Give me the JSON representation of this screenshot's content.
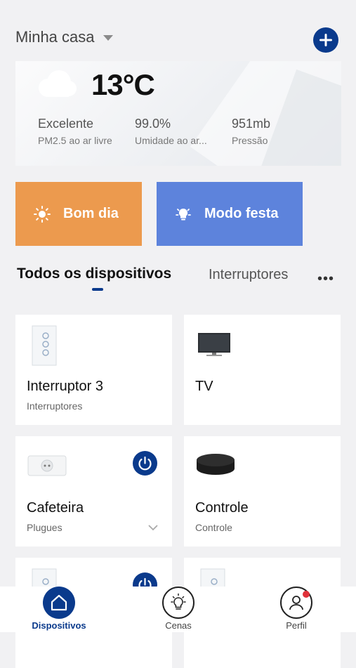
{
  "header": {
    "home_title": "Minha casa"
  },
  "weather": {
    "temperature": "13°C",
    "stats": [
      {
        "value": "Excelente",
        "label": "PM2.5 ao ar livre"
      },
      {
        "value": "99.0%",
        "label": "Umidade ao ar..."
      },
      {
        "value": "951mb",
        "label": "Pressão"
      }
    ]
  },
  "scenes": [
    {
      "label": "Bom dia",
      "color": "#ec9a4e"
    },
    {
      "label": "Modo festa",
      "color": "#5d83dc"
    }
  ],
  "tabs": {
    "active": "Todos os dispositivos",
    "other": "Interruptores",
    "more": "•••"
  },
  "devices": [
    {
      "name": "Interruptor 3",
      "category": "Interruptores",
      "icon": "wall-switch-3-gang-icon"
    },
    {
      "name": "TV",
      "category": "",
      "icon": "tv-icon"
    },
    {
      "name": "Cafeteira",
      "category": "Plugues",
      "icon": "plug-socket-icon",
      "power_on": true
    },
    {
      "name": "Controle",
      "category": "Controle",
      "icon": "ir-remote-hub-icon"
    },
    {
      "name": "",
      "category": "",
      "icon": "wall-switch-icon",
      "power_on": true
    },
    {
      "name": "",
      "category": "",
      "icon": "wall-switch-icon"
    }
  ],
  "bottom_nav": [
    {
      "label": "Dispositivos",
      "icon": "home-icon",
      "active": true
    },
    {
      "label": "Cenas",
      "icon": "lightbulb-icon",
      "active": false
    },
    {
      "label": "Perfil",
      "icon": "user-icon",
      "active": false,
      "notification_dot": true
    }
  ],
  "colors": {
    "accent": "#0a3a8c",
    "background": "#f1f1f3"
  }
}
